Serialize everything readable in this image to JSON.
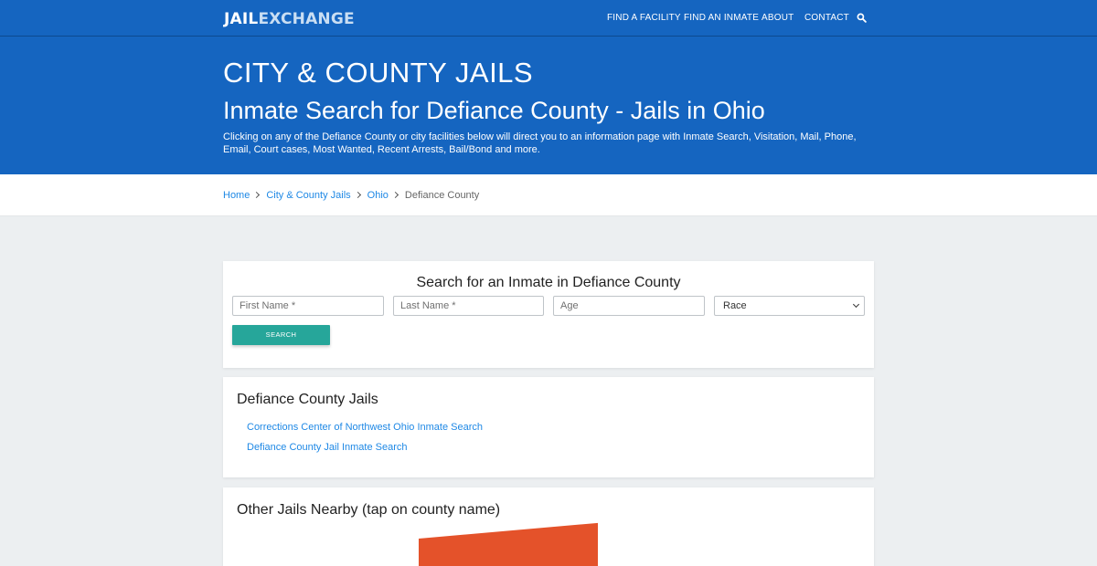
{
  "header": {
    "logo_part1": "JAIL",
    "logo_part2": "EXCHANGE",
    "nav": [
      "FIND A FACILITY",
      "FIND AN INMATE",
      "ABOUT",
      "CONTACT"
    ],
    "search_icon": "search-icon"
  },
  "hero": {
    "title": "CITY & COUNTY JAILS",
    "subtitle": "Inmate Search for Defiance County - Jails in Ohio",
    "description": "Clicking on any of the Defiance County or city facilities below will direct you to an information page with Inmate Search, Visitation, Mail, Phone, Email, Court cases, Most Wanted, Recent Arrests, Bail/Bond and more."
  },
  "breadcrumb": {
    "items": [
      "Home",
      "City & County Jails",
      "Ohio"
    ],
    "current": "Defiance County"
  },
  "search_form": {
    "title": "Search for an Inmate in Defiance County",
    "first_name_placeholder": "First Name *",
    "last_name_placeholder": "Last Name *",
    "age_placeholder": "Age",
    "race_selected": "Race",
    "button_label": "SEARCH"
  },
  "jails": {
    "heading": "Defiance County Jails",
    "links": [
      "Corrections Center of Northwest Ohio Inmate Search",
      "Defiance County Jail Inmate Search"
    ]
  },
  "nearby": {
    "heading": "Other Jails Nearby (tap on county name)",
    "map_color": "#e4522a"
  },
  "colors": {
    "brand_blue": "#1565c0",
    "link_blue": "#1e88e5",
    "button_teal": "#26a69a"
  }
}
